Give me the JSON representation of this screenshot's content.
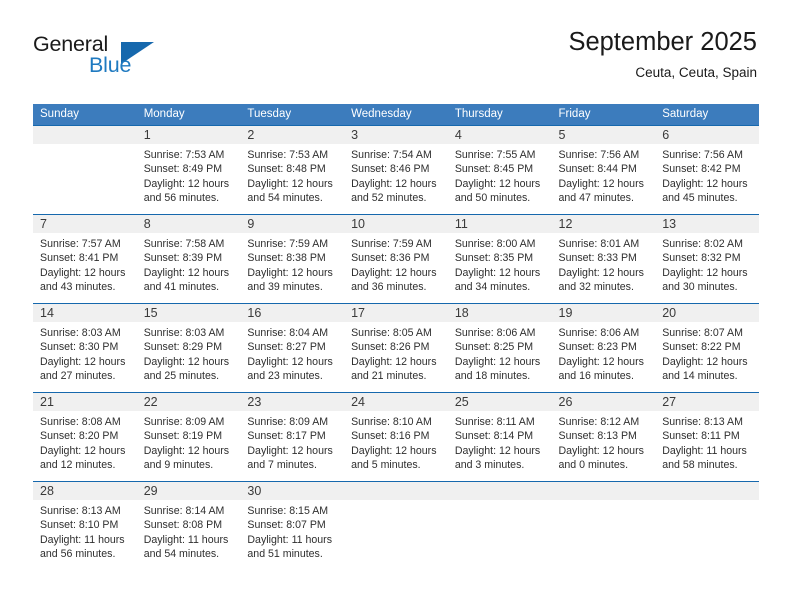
{
  "logo": {
    "word1": "General",
    "word2": "Blue",
    "accent_color": "#1668ad",
    "triangle_icon": "triangle-icon"
  },
  "header": {
    "title": "September 2025",
    "subtitle": "Ceuta, Ceuta, Spain"
  },
  "calendar": {
    "header_bg": "#3c7cbd",
    "row_border_color": "#1668ad",
    "daynum_bg": "#f0f0f0",
    "weekday_headers": [
      "Sunday",
      "Monday",
      "Tuesday",
      "Wednesday",
      "Thursday",
      "Friday",
      "Saturday"
    ],
    "weeks": [
      [
        {
          "day": "",
          "sunrise": "",
          "sunset": "",
          "daylight1": "",
          "daylight2": ""
        },
        {
          "day": "1",
          "sunrise": "Sunrise: 7:53 AM",
          "sunset": "Sunset: 8:49 PM",
          "daylight1": "Daylight: 12 hours",
          "daylight2": "and 56 minutes."
        },
        {
          "day": "2",
          "sunrise": "Sunrise: 7:53 AM",
          "sunset": "Sunset: 8:48 PM",
          "daylight1": "Daylight: 12 hours",
          "daylight2": "and 54 minutes."
        },
        {
          "day": "3",
          "sunrise": "Sunrise: 7:54 AM",
          "sunset": "Sunset: 8:46 PM",
          "daylight1": "Daylight: 12 hours",
          "daylight2": "and 52 minutes."
        },
        {
          "day": "4",
          "sunrise": "Sunrise: 7:55 AM",
          "sunset": "Sunset: 8:45 PM",
          "daylight1": "Daylight: 12 hours",
          "daylight2": "and 50 minutes."
        },
        {
          "day": "5",
          "sunrise": "Sunrise: 7:56 AM",
          "sunset": "Sunset: 8:44 PM",
          "daylight1": "Daylight: 12 hours",
          "daylight2": "and 47 minutes."
        },
        {
          "day": "6",
          "sunrise": "Sunrise: 7:56 AM",
          "sunset": "Sunset: 8:42 PM",
          "daylight1": "Daylight: 12 hours",
          "daylight2": "and 45 minutes."
        }
      ],
      [
        {
          "day": "7",
          "sunrise": "Sunrise: 7:57 AM",
          "sunset": "Sunset: 8:41 PM",
          "daylight1": "Daylight: 12 hours",
          "daylight2": "and 43 minutes."
        },
        {
          "day": "8",
          "sunrise": "Sunrise: 7:58 AM",
          "sunset": "Sunset: 8:39 PM",
          "daylight1": "Daylight: 12 hours",
          "daylight2": "and 41 minutes."
        },
        {
          "day": "9",
          "sunrise": "Sunrise: 7:59 AM",
          "sunset": "Sunset: 8:38 PM",
          "daylight1": "Daylight: 12 hours",
          "daylight2": "and 39 minutes."
        },
        {
          "day": "10",
          "sunrise": "Sunrise: 7:59 AM",
          "sunset": "Sunset: 8:36 PM",
          "daylight1": "Daylight: 12 hours",
          "daylight2": "and 36 minutes."
        },
        {
          "day": "11",
          "sunrise": "Sunrise: 8:00 AM",
          "sunset": "Sunset: 8:35 PM",
          "daylight1": "Daylight: 12 hours",
          "daylight2": "and 34 minutes."
        },
        {
          "day": "12",
          "sunrise": "Sunrise: 8:01 AM",
          "sunset": "Sunset: 8:33 PM",
          "daylight1": "Daylight: 12 hours",
          "daylight2": "and 32 minutes."
        },
        {
          "day": "13",
          "sunrise": "Sunrise: 8:02 AM",
          "sunset": "Sunset: 8:32 PM",
          "daylight1": "Daylight: 12 hours",
          "daylight2": "and 30 minutes."
        }
      ],
      [
        {
          "day": "14",
          "sunrise": "Sunrise: 8:03 AM",
          "sunset": "Sunset: 8:30 PM",
          "daylight1": "Daylight: 12 hours",
          "daylight2": "and 27 minutes."
        },
        {
          "day": "15",
          "sunrise": "Sunrise: 8:03 AM",
          "sunset": "Sunset: 8:29 PM",
          "daylight1": "Daylight: 12 hours",
          "daylight2": "and 25 minutes."
        },
        {
          "day": "16",
          "sunrise": "Sunrise: 8:04 AM",
          "sunset": "Sunset: 8:27 PM",
          "daylight1": "Daylight: 12 hours",
          "daylight2": "and 23 minutes."
        },
        {
          "day": "17",
          "sunrise": "Sunrise: 8:05 AM",
          "sunset": "Sunset: 8:26 PM",
          "daylight1": "Daylight: 12 hours",
          "daylight2": "and 21 minutes."
        },
        {
          "day": "18",
          "sunrise": "Sunrise: 8:06 AM",
          "sunset": "Sunset: 8:25 PM",
          "daylight1": "Daylight: 12 hours",
          "daylight2": "and 18 minutes."
        },
        {
          "day": "19",
          "sunrise": "Sunrise: 8:06 AM",
          "sunset": "Sunset: 8:23 PM",
          "daylight1": "Daylight: 12 hours",
          "daylight2": "and 16 minutes."
        },
        {
          "day": "20",
          "sunrise": "Sunrise: 8:07 AM",
          "sunset": "Sunset: 8:22 PM",
          "daylight1": "Daylight: 12 hours",
          "daylight2": "and 14 minutes."
        }
      ],
      [
        {
          "day": "21",
          "sunrise": "Sunrise: 8:08 AM",
          "sunset": "Sunset: 8:20 PM",
          "daylight1": "Daylight: 12 hours",
          "daylight2": "and 12 minutes."
        },
        {
          "day": "22",
          "sunrise": "Sunrise: 8:09 AM",
          "sunset": "Sunset: 8:19 PM",
          "daylight1": "Daylight: 12 hours",
          "daylight2": "and 9 minutes."
        },
        {
          "day": "23",
          "sunrise": "Sunrise: 8:09 AM",
          "sunset": "Sunset: 8:17 PM",
          "daylight1": "Daylight: 12 hours",
          "daylight2": "and 7 minutes."
        },
        {
          "day": "24",
          "sunrise": "Sunrise: 8:10 AM",
          "sunset": "Sunset: 8:16 PM",
          "daylight1": "Daylight: 12 hours",
          "daylight2": "and 5 minutes."
        },
        {
          "day": "25",
          "sunrise": "Sunrise: 8:11 AM",
          "sunset": "Sunset: 8:14 PM",
          "daylight1": "Daylight: 12 hours",
          "daylight2": "and 3 minutes."
        },
        {
          "day": "26",
          "sunrise": "Sunrise: 8:12 AM",
          "sunset": "Sunset: 8:13 PM",
          "daylight1": "Daylight: 12 hours",
          "daylight2": "and 0 minutes."
        },
        {
          "day": "27",
          "sunrise": "Sunrise: 8:13 AM",
          "sunset": "Sunset: 8:11 PM",
          "daylight1": "Daylight: 11 hours",
          "daylight2": "and 58 minutes."
        }
      ],
      [
        {
          "day": "28",
          "sunrise": "Sunrise: 8:13 AM",
          "sunset": "Sunset: 8:10 PM",
          "daylight1": "Daylight: 11 hours",
          "daylight2": "and 56 minutes."
        },
        {
          "day": "29",
          "sunrise": "Sunrise: 8:14 AM",
          "sunset": "Sunset: 8:08 PM",
          "daylight1": "Daylight: 11 hours",
          "daylight2": "and 54 minutes."
        },
        {
          "day": "30",
          "sunrise": "Sunrise: 8:15 AM",
          "sunset": "Sunset: 8:07 PM",
          "daylight1": "Daylight: 11 hours",
          "daylight2": "and 51 minutes."
        },
        {
          "day": "",
          "sunrise": "",
          "sunset": "",
          "daylight1": "",
          "daylight2": ""
        },
        {
          "day": "",
          "sunrise": "",
          "sunset": "",
          "daylight1": "",
          "daylight2": ""
        },
        {
          "day": "",
          "sunrise": "",
          "sunset": "",
          "daylight1": "",
          "daylight2": ""
        },
        {
          "day": "",
          "sunrise": "",
          "sunset": "",
          "daylight1": "",
          "daylight2": ""
        }
      ]
    ]
  }
}
